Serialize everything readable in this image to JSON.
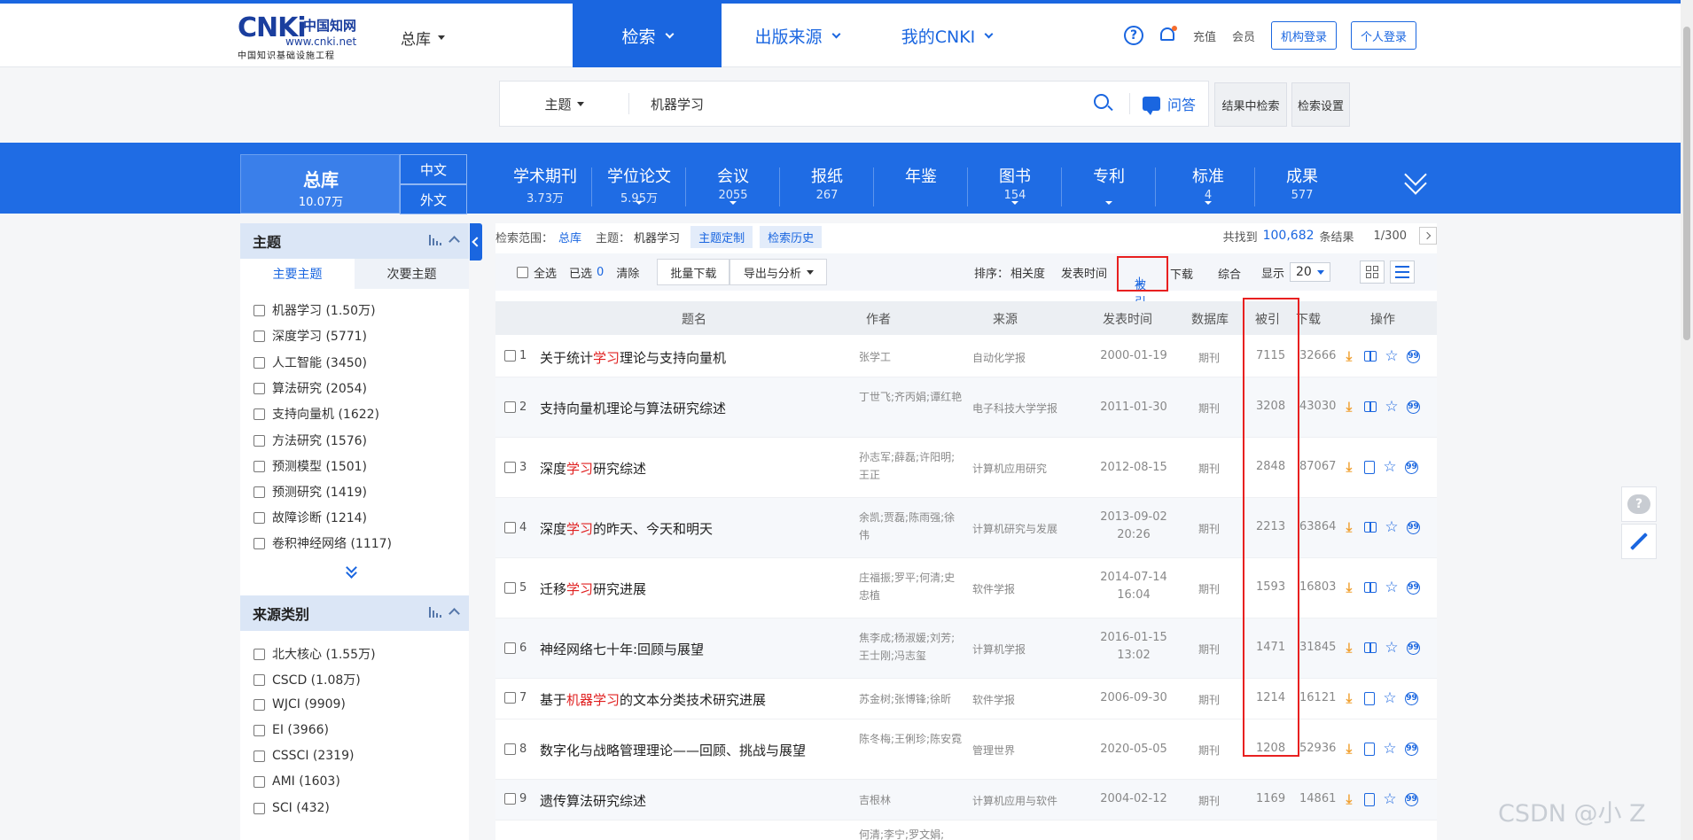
{
  "header": {
    "logo": {
      "mark": "CNKi",
      "cn_title": "中国知网",
      "url": "www.cnki.net",
      "subtitle": "中国知识基础设施工程"
    },
    "db_select": "总库",
    "nav": [
      {
        "label": "检索",
        "active": true
      },
      {
        "label": "出版来源",
        "active": false
      },
      {
        "label": "我的CNKI",
        "active": false
      }
    ],
    "help_symbol": "?",
    "recharge": "充值",
    "member": "会员",
    "org_login": "机构登录",
    "personal_login": "个人登录"
  },
  "search": {
    "field": "主题",
    "query": "机器学习",
    "qa_label": "问答",
    "in_results": "结果中检索",
    "settings": "检索设置"
  },
  "band": {
    "total": {
      "label": "总库",
      "count": "10.07万"
    },
    "lang_cn": "中文",
    "lang_foreign": "外文",
    "categories": [
      {
        "name": "学术期刊",
        "count": "3.73万",
        "arrow": false
      },
      {
        "name": "学位论文",
        "count": "5.95万",
        "arrow": true
      },
      {
        "name": "会议",
        "count": "2055",
        "arrow": true
      },
      {
        "name": "报纸",
        "count": "267",
        "arrow": false
      },
      {
        "name": "年鉴",
        "count": "",
        "arrow": false
      },
      {
        "name": "图书",
        "count": "154",
        "arrow": true
      },
      {
        "name": "专利",
        "count": "",
        "arrow": true
      },
      {
        "name": "标准",
        "count": "4",
        "arrow": true
      },
      {
        "name": "成果",
        "count": "577",
        "arrow": false
      }
    ]
  },
  "sidebar": {
    "topic": {
      "title": "主题",
      "tab_main": "主要主题",
      "tab_secondary": "次要主题",
      "items": [
        "机器学习 (1.50万)",
        "深度学习 (5771)",
        "人工智能 (3450)",
        "算法研究 (2054)",
        "支持向量机 (1622)",
        "方法研究 (1576)",
        "预测模型 (1501)",
        "预测研究 (1419)",
        "故障诊断 (1214)",
        "卷积神经网络 (1117)"
      ]
    },
    "source": {
      "title": "来源类别",
      "items": [
        "北大核心 (1.55万)",
        "CSCD (1.08万)",
        "WJCI (9909)",
        "EI (3966)",
        "CSSCI (2319)",
        "AMI (1603)",
        "SCI (432)"
      ]
    }
  },
  "results": {
    "scope_label": "检索范围：",
    "scope_value": "总库",
    "topic_label": "主题：",
    "topic_value": "机器学习",
    "custom_topic": "主题定制",
    "history": "检索历史",
    "found_prefix": "共找到",
    "found_count": "100,682",
    "found_suffix": "条结果",
    "page": "1/300",
    "toolbar": {
      "select_all": "全选",
      "selected_label": "已选",
      "selected_count": "0",
      "clear": "清除",
      "batch_download": "批量下载",
      "export": "导出与分析",
      "sort_label": "排序：",
      "sort_relevance": "相关度",
      "sort_date": "发表时间",
      "sort_cite": "被引",
      "sort_download": "下载",
      "sort_combined": "综合",
      "show_label": "显示",
      "show_value": "20"
    },
    "columns": {
      "title": "题名",
      "author": "作者",
      "source": "来源",
      "date": "发表时间",
      "db": "数据库",
      "cite": "被引",
      "download": "下载",
      "ops": "操作"
    },
    "rows": [
      {
        "no": "1",
        "pre": "关于统计",
        "hl": "学习",
        "post": "理论与支持向量机",
        "author": "张学工",
        "source": "自动化学报",
        "date": "2000-01-19",
        "db": "期刊",
        "cite": "7115",
        "dl": "32666"
      },
      {
        "no": "2",
        "pre": "支持向量机理论与算法研究综述",
        "hl": "",
        "post": "",
        "author": "丁世飞;齐丙娟;谭红艳",
        "source": "电子科技大学学报",
        "date": "2011-01-30",
        "db": "期刊",
        "cite": "3208",
        "dl": "43030"
      },
      {
        "no": "3",
        "pre": "深度",
        "hl": "学习",
        "post": "研究综述",
        "author": "孙志军;薛磊;许阳明;王正",
        "source": "计算机应用研究",
        "date": "2012-08-15",
        "db": "期刊",
        "cite": "2848",
        "dl": "87067"
      },
      {
        "no": "4",
        "pre": "深度",
        "hl": "学习",
        "post": "的昨天、今天和明天",
        "author": "余凯;贾磊;陈雨强;徐伟",
        "source": "计算机研究与发展",
        "date": "2013-09-02 20:26",
        "db": "期刊",
        "cite": "2213",
        "dl": "63864"
      },
      {
        "no": "5",
        "pre": "迁移",
        "hl": "学习",
        "post": "研究进展",
        "author": "庄福振;罗平;何清;史忠植",
        "source": "软件学报",
        "date": "2014-07-14 16:04",
        "db": "期刊",
        "cite": "1593",
        "dl": "16803"
      },
      {
        "no": "6",
        "pre": "神经网络七十年:回顾与展望",
        "hl": "",
        "post": "",
        "author": "焦李成;杨淑媛;刘芳;王士刚;冯志玺",
        "source": "计算机学报",
        "date": "2016-01-15 13:02",
        "db": "期刊",
        "cite": "1471",
        "dl": "31845"
      },
      {
        "no": "7",
        "pre": "基于",
        "hl": "机器学习",
        "post": "的文本分类技术研究进展",
        "author": "苏金树;张博锋;徐昕",
        "source": "软件学报",
        "date": "2006-09-30",
        "db": "期刊",
        "cite": "1214",
        "dl": "16121"
      },
      {
        "no": "8",
        "pre": "数字化与战略管理理论——回顾、挑战与展望",
        "hl": "",
        "post": "",
        "author": "陈冬梅;王俐珍;陈安霓",
        "source": "管理世界",
        "date": "2020-05-05",
        "db": "期刊",
        "cite": "1208",
        "dl": "52936"
      },
      {
        "no": "9",
        "pre": "遗传算法研究综述",
        "hl": "",
        "post": "",
        "author": "吉根林",
        "source": "计算机应用与软件",
        "date": "2004-02-12",
        "db": "期刊",
        "cite": "1169",
        "dl": "14861"
      }
    ],
    "next_author_partial": "何清;李宁;罗文娟;"
  },
  "watermark": "CSDN @小 Z"
}
